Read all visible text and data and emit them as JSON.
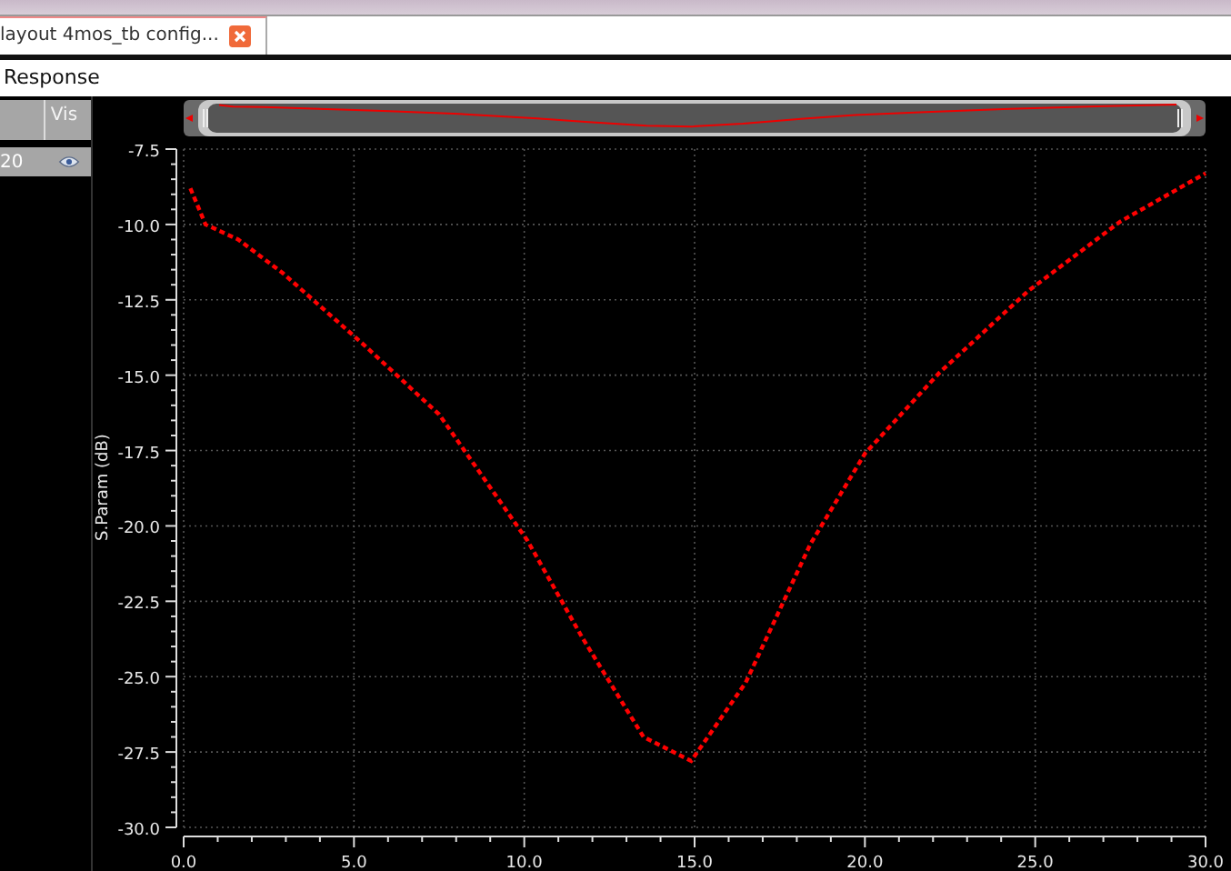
{
  "tab": {
    "label": "layout 4mos_tb config...",
    "selected": true
  },
  "panel": {
    "title": "Response"
  },
  "trace_list": {
    "column": "Vis",
    "rows": [
      {
        "label": "20",
        "visible": true
      }
    ]
  },
  "chart_data": {
    "type": "line",
    "ylabel": "S.Param (dB)",
    "xlim": [
      0,
      30
    ],
    "ylim": [
      -30,
      -7.5
    ],
    "xticks": [
      {
        "value": 0,
        "label": "0.0"
      },
      {
        "value": 5,
        "label": "5.0"
      },
      {
        "value": 10,
        "label": "10.0"
      },
      {
        "value": 15,
        "label": "15.0"
      },
      {
        "value": 20,
        "label": "20.0"
      },
      {
        "value": 25,
        "label": "25.0"
      },
      {
        "value": 30,
        "label": "30.0"
      }
    ],
    "yticks": [
      -7.5,
      {
        "value": -10,
        "label": "-10.0"
      },
      -12.5,
      {
        "value": -15,
        "label": "-15.0"
      },
      -17.5,
      {
        "value": -20,
        "label": "-20.0"
      },
      -22.5,
      {
        "value": -25,
        "label": "-25.0"
      },
      -27.5,
      {
        "value": -30,
        "label": "-30.0"
      }
    ],
    "grid": true,
    "x": [
      0.2,
      0.64,
      1.6,
      2.9,
      5.3,
      7.5,
      10.1,
      11.7,
      13.5,
      14.9,
      16.5,
      18.4,
      20.0,
      22.2,
      24.8,
      27.5,
      30.0
    ],
    "series": [
      {
        "color": "#ff0000",
        "line_style": "dashed",
        "values": [
          -8.8,
          -10.0,
          -10.5,
          -11.6,
          -14.0,
          -16.3,
          -20.5,
          -23.7,
          -27.0,
          -27.8,
          -25.2,
          -20.6,
          -17.6,
          -14.9,
          -12.2,
          -9.9,
          -8.3
        ]
      }
    ]
  }
}
